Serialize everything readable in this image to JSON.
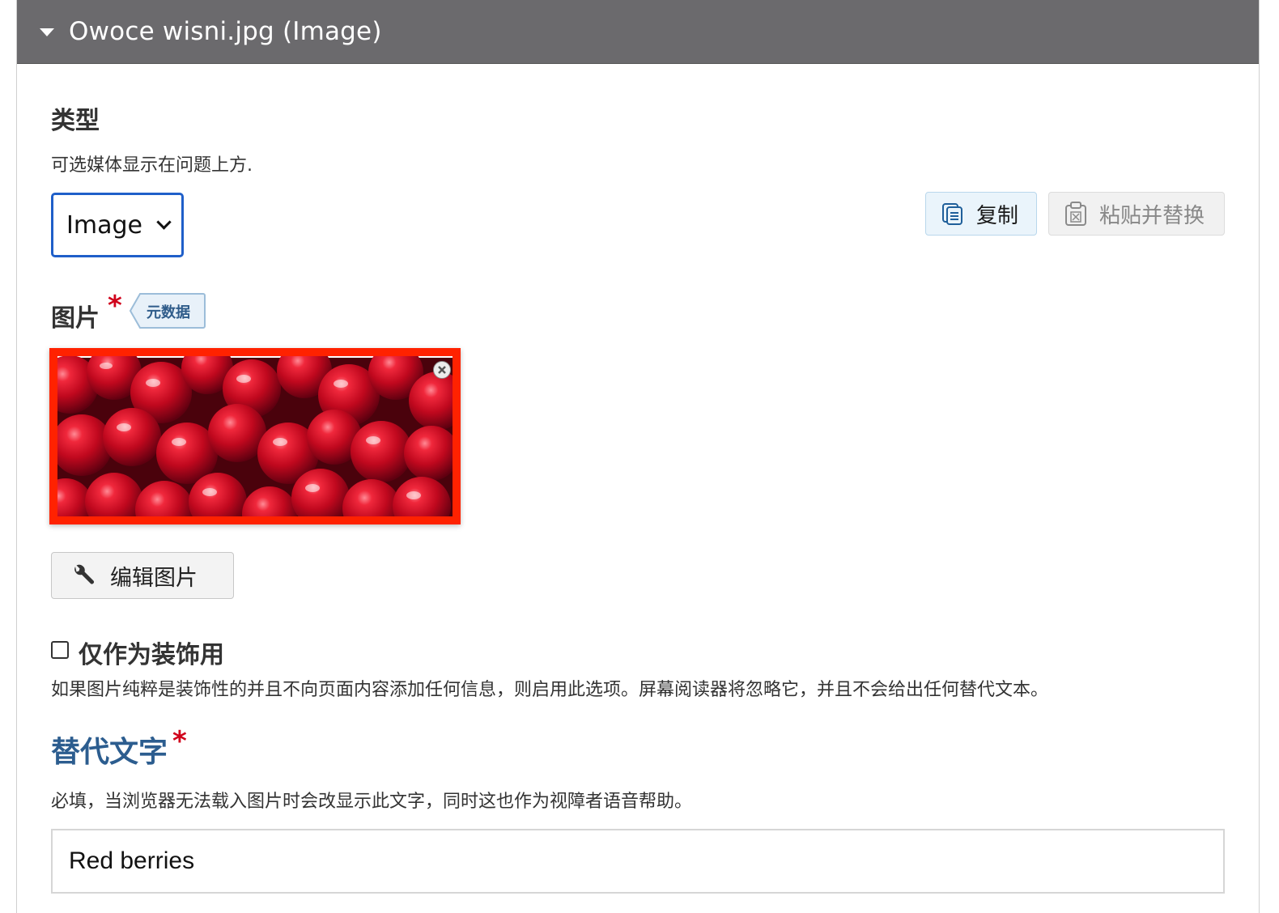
{
  "header": {
    "title": "Owoce wisni.jpg (Image)"
  },
  "type_section": {
    "label": "类型",
    "description": "可选媒体显示在问题上方.",
    "selected": "Image"
  },
  "toolbar": {
    "copy_label": "复制",
    "paste_label": "粘贴并替换"
  },
  "image_section": {
    "label": "图片",
    "required_mark": "*",
    "metadata_tag": "元数据",
    "edit_button": "编辑图片"
  },
  "decorative": {
    "label": "仅作为装饰用",
    "description": "如果图片纯粹是装饰性的并且不向页面内容添加任何信息，则启用此选项。屏幕阅读器将忽略它，并且不会给出任何替代文本。",
    "checked": false
  },
  "alt_text": {
    "label": "替代文字",
    "required_mark": "*",
    "description": "必填，当浏览器无法载入图片时会改显示此文字，同时这也作为视障者语音帮助。",
    "value": "Red berries"
  },
  "colors": {
    "header_bg": "#6b6a6d",
    "accent_blue": "#1f5fc9",
    "required_red": "#d0021b",
    "image_border": "#ff2200",
    "alt_label": "#2c5d8f"
  },
  "icons": {
    "header": "caret-down-icon",
    "copy": "copy-icon",
    "paste": "paste-icon",
    "edit": "wrench-icon",
    "remove": "close-icon"
  }
}
